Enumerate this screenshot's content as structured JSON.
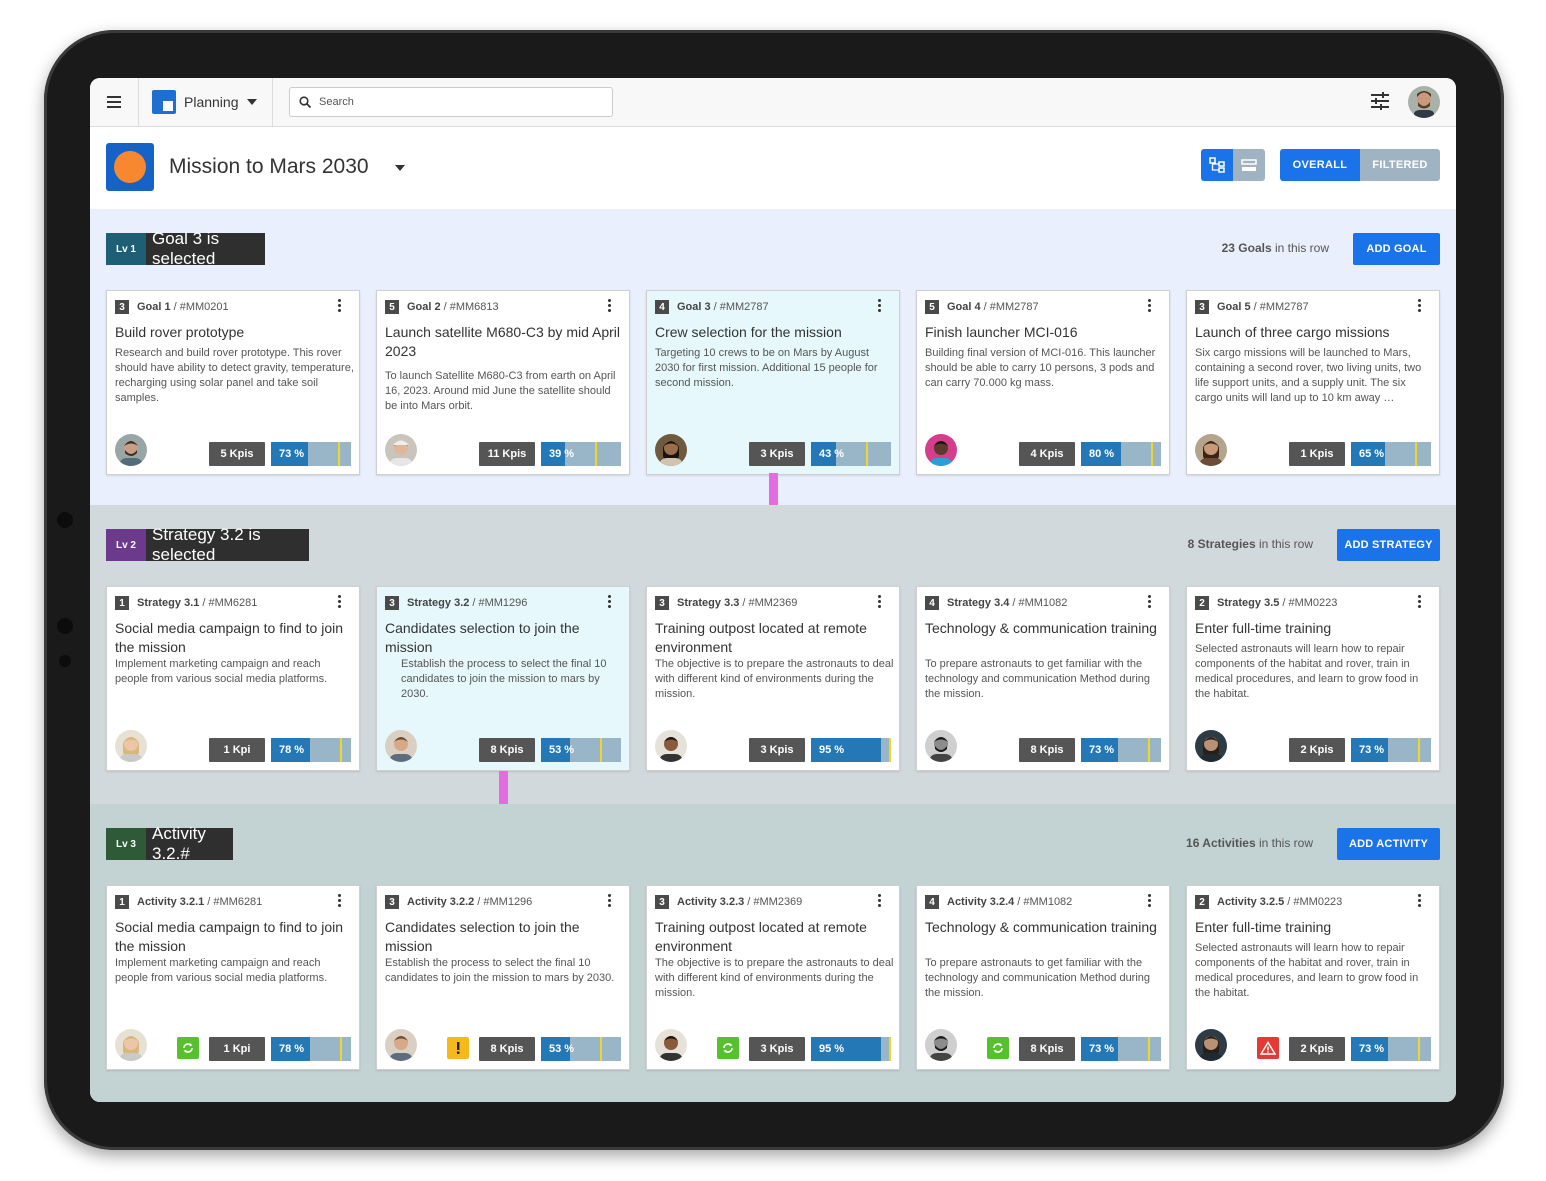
{
  "app": {
    "name": "Planning",
    "search_placeholder": "Search"
  },
  "mission": {
    "title": "Mission to Mars 2030"
  },
  "view": {
    "segments": [
      "OVERALL",
      "FILTERED"
    ],
    "active_segment": "OVERALL"
  },
  "colors": {
    "primary": "#1a73e8",
    "lv1": "#1f5f75",
    "lv2": "#6c3a8c",
    "lv3": "#2e5a37",
    "progress_fill": "#2478b5",
    "progress_track": "#98b6c8",
    "marker": "#f0d52c",
    "ok_status": "#57c02f",
    "warn_status": "#f5b91e",
    "alert_status": "#e53935",
    "connector": "#e46be0"
  },
  "rows": [
    {
      "level": "Lv 1",
      "label": "Goal 3 is selected",
      "count_strong": "23 Goals",
      "count_rest": " in this row",
      "button": "ADD GOAL",
      "cards": [
        {
          "num": "3",
          "name": "Goal 1",
          "code": "/  #MM0201",
          "title": "Build rover prototype",
          "desc": "Research and build rover prototype. This rover should have ability to detect gravity, temperature, recharging using solar panel and take soil samples.",
          "kpis": "5 Kpis",
          "pct": "73 %",
          "progress": 0.73,
          "avatar": "man-beard",
          "selected": false
        },
        {
          "num": "5",
          "name": "Goal 2",
          "code": "/ #MM6813",
          "title": "Launch satellite M680-C3 by mid April 2023",
          "desc": "To launch Satellite M680-C3 from earth on April 16, 2023. Around mid June the satellite should be into Mars orbit.",
          "kpis": "11 Kpis",
          "pct": "39 %",
          "progress": 0.39,
          "avatar": "man-cap",
          "selected": false
        },
        {
          "num": "4",
          "name": "Goal 3",
          "code": "/ #MM2787",
          "title": "Crew selection for the mission",
          "desc": "Targeting 10 crews to be on Mars by August 2030 for first mission. Additional 15 people for second mission.",
          "kpis": "3 Kpis",
          "pct": "43 %",
          "progress": 0.43,
          "avatar": "woman-dark",
          "selected": true
        },
        {
          "num": "5",
          "name": "Goal 4",
          "code": "/ #MM2787",
          "title": "Finish launcher MCI-016",
          "desc": "Building final version of MCI-016. This launcher should be able to carry 10 persons, 3 pods and can carry 70.000 kg mass.",
          "kpis": "4 Kpis",
          "pct": "80 %",
          "progress": 0.8,
          "avatar": "man-color",
          "selected": false
        },
        {
          "num": "3",
          "name": "Goal 5",
          "code": "/ #MM2787",
          "title": "Launch of three cargo missions",
          "desc": "Six cargo missions will be launched to Mars, containing a second rover, two living units, two life support units, and a supply unit. The six cargo units will land up to 10 km away …",
          "kpis": "1 Kpis",
          "pct": "65 %",
          "progress": 0.65,
          "avatar": "woman-curly",
          "selected": false
        }
      ]
    },
    {
      "level": "Lv 2",
      "label": "Strategy 3.2 is selected",
      "count_strong": "8 Strategies",
      "count_rest": " in this row",
      "button": "ADD STRATEGY",
      "cards": [
        {
          "num": "1",
          "name": "Strategy 3.1",
          "code": "/ #MM6281",
          "title": "Social media campaign to find to join the mission",
          "desc": "Implement marketing campaign and reach people from various social media platforms.",
          "kpis": "1 Kpi",
          "pct": "78 %",
          "progress": 0.78,
          "avatar": "woman-blonde",
          "selected": false
        },
        {
          "num": "3",
          "name": "Strategy 3.2",
          "code": "/ #MM1296",
          "title": "Candidates selection to join the mission",
          "desc": "Establish the process to select the final 10 candidates to join the mission to mars by 2030.",
          "kpis": "8 Kpis",
          "pct": "53 %",
          "progress": 0.53,
          "avatar": "man-short",
          "selected": true
        },
        {
          "num": "3",
          "name": "Strategy 3.3",
          "code": "/ #MM2369",
          "title": "Training outpost located at remote environment",
          "desc": "The objective is to prepare the astronauts to deal with different kind of environments during the mission.",
          "kpis": "3 Kpis",
          "pct": "95 %",
          "progress": 0.95,
          "avatar": "man-dark",
          "selected": false
        },
        {
          "num": "4",
          "name": "Strategy 3.4",
          "code": "/ #MM1082",
          "title": "Technology & communication training",
          "desc": "To prepare astronauts to get familiar with the technology and communication Method during the mission.",
          "kpis": "8 Kpis",
          "pct": "73 %",
          "progress": 0.73,
          "avatar": "man-bw",
          "selected": false
        },
        {
          "num": "2",
          "name": "Strategy 3.5",
          "code": "/ #MM0223",
          "title": "Enter full-time training",
          "desc": "Selected astronauts will learn how to repair components of the habitat and rover, train in medical procedures, and learn to grow food in the habitat.",
          "kpis": "2 Kpis",
          "pct": "73 %",
          "progress": 0.73,
          "avatar": "woman-gray",
          "selected": false
        }
      ]
    },
    {
      "level": "Lv 3",
      "label": "Activity 3.2.#",
      "count_strong": "16 Activities",
      "count_rest": " in this row",
      "button": "ADD ACTIVITY",
      "cards": [
        {
          "num": "1",
          "name": "Activity 3.2.1",
          "code": "/ #MM6281",
          "title": "Social media campaign to find to join the mission",
          "desc": "Implement marketing campaign and reach people from various social media platforms.",
          "kpis": "1 Kpi",
          "pct": "78 %",
          "progress": 0.78,
          "avatar": "woman-blonde",
          "status": "refresh",
          "selected": false
        },
        {
          "num": "3",
          "name": "Activity 3.2.2",
          "code": "/ #MM1296",
          "title": "Candidates selection to join the mission",
          "desc": "Establish the process to select the final 10 candidates to join the mission to mars by 2030.",
          "kpis": "8 Kpis",
          "pct": "53 %",
          "progress": 0.53,
          "avatar": "man-short",
          "status": "warning",
          "selected": false
        },
        {
          "num": "3",
          "name": "Activity 3.2.3",
          "code": "/ #MM2369",
          "title": "Training outpost located at remote environment",
          "desc": "The objective is to prepare the astronauts to deal with different kind of environments during the mission.",
          "kpis": "3 Kpis",
          "pct": "95 %",
          "progress": 0.95,
          "avatar": "man-dark",
          "status": "refresh",
          "selected": false
        },
        {
          "num": "4",
          "name": "Activity 3.2.4",
          "code": "/ #MM1082",
          "title": "Technology & communication training",
          "desc": "To prepare astronauts to get familiar with the technology and communication Method during the mission.",
          "kpis": "8 Kpis",
          "pct": "73 %",
          "progress": 0.73,
          "avatar": "man-bw",
          "status": "refresh",
          "selected": false
        },
        {
          "num": "2",
          "name": "Activity 3.2.5",
          "code": "/ #MM0223",
          "title": "Enter full-time training",
          "desc": "Selected astronauts will learn how to repair components of the habitat and rover, train in medical procedures, and learn to grow food in the habitat.",
          "kpis": "2 Kpis",
          "pct": "73 %",
          "progress": 0.73,
          "avatar": "woman-gray",
          "status": "alert",
          "selected": false
        }
      ]
    }
  ]
}
